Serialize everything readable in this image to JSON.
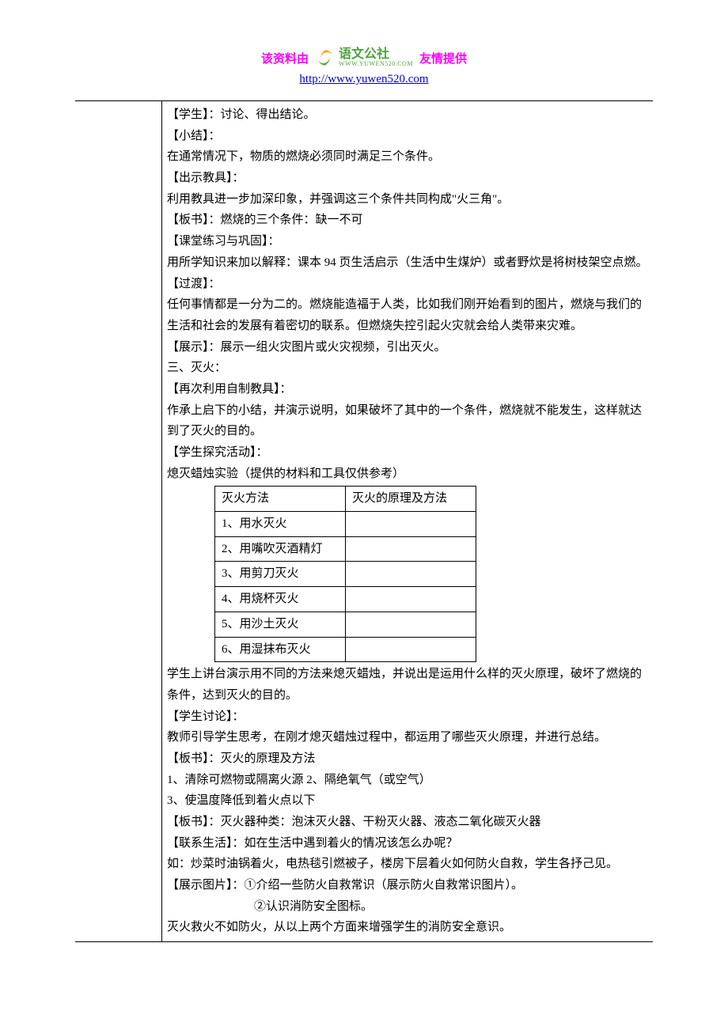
{
  "header": {
    "left": "该资料由",
    "right": "友情提供",
    "logo_cn": "语文公社",
    "logo_en": "WWW.YUWEN520.COM",
    "url": "http://www.yuwen520.com"
  },
  "body": {
    "p01": "【学生】：讨论、得出结论。",
    "p02": "【小结】：",
    "p03": "在通常情况下，物质的燃烧必须同时满足三个条件。",
    "p04": "【出示教具】：",
    "p05": "利用教具进一步加深印象，并强调这三个条件共同构成\"火三角\"。",
    "p06": "【板书】：燃烧的三个条件：缺一不可",
    "p07": "【课堂练习与巩固】：",
    "p08": "用所学知识来加以解释：课本 94 页生活启示（生活中生煤炉）或者野炊是将树枝架空点燃。",
    "p09": "【过渡】：",
    "p10": "任何事情都是一分为二的。燃烧能造福于人类，比如我们刚开始看到的图片，燃烧与我们的生活和社会的发展有着密切的联系。但燃烧失控引起火灾就会给人类带来灾难。",
    "p11": "【展示】：展示一组火灾图片或火灾视频，引出灭火。",
    "p12": "三、灭火：",
    "p13": "【再次利用自制教具】：",
    "p14": "作承上启下的小结，并演示说明，如果破坏了其中的一个条件，燃烧就不能发生，这样就达到了灭火的目的。",
    "p15": "【学生探究活动】：",
    "p16": "熄灭蜡烛实验（提供的材料和工具仅供参考）",
    "tbl": {
      "h1": "灭火方法",
      "h2": "灭火的原理及方法",
      "r1": "1、用水灭火",
      "r2": "2、用嘴吹灭酒精灯",
      "r3": "3、用剪刀灭火",
      "r4": "4、用烧杯灭火",
      "r5": "5、用沙土灭火",
      "r6": "6、用湿抹布灭火"
    },
    "p17": "学生上讲台演示用不同的方法来熄灭蜡烛，并说出是运用什么样的灭火原理，破坏了燃烧的条件，达到灭火的目的。",
    "p18": "【学生讨论】：",
    "p19": "教师引导学生思考，在刚才熄灭蜡烛过程中，都运用了哪些灭火原理，并进行总结。",
    "p20": "【板书】：灭火的原理及方法",
    "p21": "1、清除可燃物或隔离火源   2、隔绝氧气（或空气）",
    "p22": "3、使温度降低到着火点以下",
    "p23": "【板书】：灭火器种类：泡沫灭火器、干粉灭火器、液态二氧化碳灭火器",
    "p24": "【联系生活】：如在生活中遇到着火的情况该怎么办呢？",
    "p25": "如：炒菜时油锅着火，电热毯引燃被子，楼房下层着火如何防火自救，学生各抒己见。",
    "p26": "【展示图片】：①介绍一些防火自救常识（展示防火自救常识图片）。",
    "p27": "②认识消防安全图标。",
    "p28": "灭火救火不如防火，从以上两个方面来增强学生的消防安全意识。"
  }
}
